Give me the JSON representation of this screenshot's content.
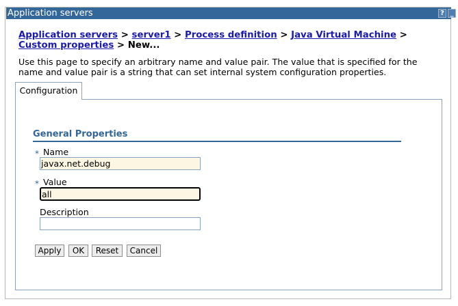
{
  "window": {
    "title": "Application servers",
    "help_icon": "?",
    "minimize_icon": "_"
  },
  "breadcrumb": {
    "links": [
      "Application servers",
      "server1",
      "Process definition",
      "Java Virtual Machine",
      "Custom properties"
    ],
    "separator": ">",
    "current": "New..."
  },
  "description": "Use this page to specify an arbitrary name and value pair. The value that is specified for the name and value pair is a string that can set internal system configuration properties.",
  "tab": {
    "label": "Configuration"
  },
  "section": {
    "title": "General Properties"
  },
  "form": {
    "required_marker": "*",
    "name": {
      "label": "Name",
      "value": "javax.net.debug"
    },
    "value": {
      "label": "Value",
      "value": "all"
    },
    "description": {
      "label": "Description",
      "value": ""
    }
  },
  "buttons": {
    "apply": "Apply",
    "ok": "OK",
    "reset": "Reset",
    "cancel": "Cancel"
  }
}
